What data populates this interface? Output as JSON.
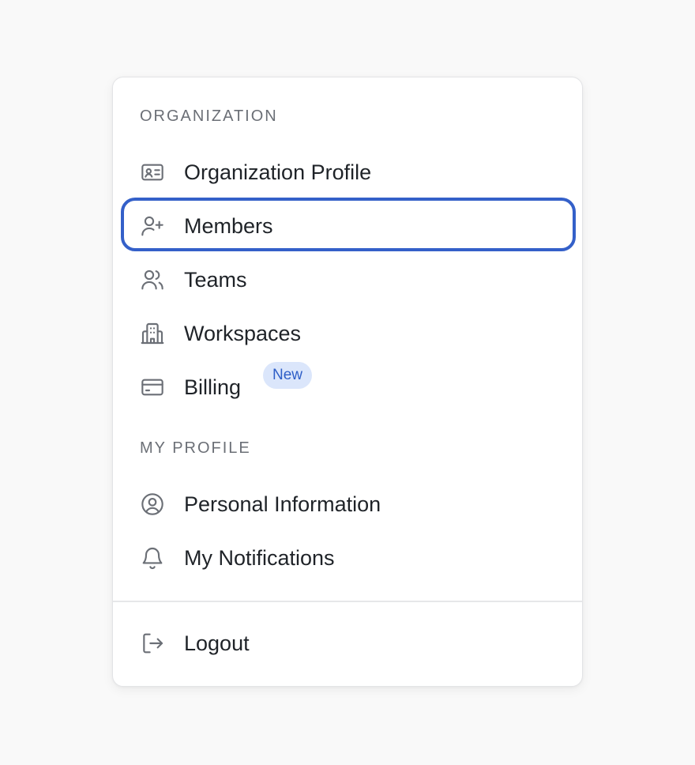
{
  "sections": {
    "organization": {
      "heading": "ORGANIZATION",
      "items": [
        {
          "label": "Organization Profile",
          "icon": "id-card-icon"
        },
        {
          "label": "Members",
          "icon": "user-plus-icon"
        },
        {
          "label": "Teams",
          "icon": "users-icon"
        },
        {
          "label": "Workspaces",
          "icon": "building-icon"
        },
        {
          "label": "Billing",
          "icon": "credit-card-icon",
          "badge": "New"
        }
      ]
    },
    "my_profile": {
      "heading": "MY PROFILE",
      "items": [
        {
          "label": "Personal Information",
          "icon": "user-circle-icon"
        },
        {
          "label": "My Notifications",
          "icon": "bell-icon"
        }
      ]
    }
  },
  "footer": {
    "logout": {
      "label": "Logout",
      "icon": "logout-icon"
    }
  },
  "focused_item": "Members",
  "colors": {
    "page_background": "#f9f9f9",
    "menu_background": "#ffffff",
    "focus_ring": "#3460c9",
    "heading_text": "#6b6f76",
    "item_text": "#1f2328",
    "icon_stroke": "#6b6f76",
    "badge_background": "#dbe6fb",
    "badge_text": "#2e5ec7"
  }
}
